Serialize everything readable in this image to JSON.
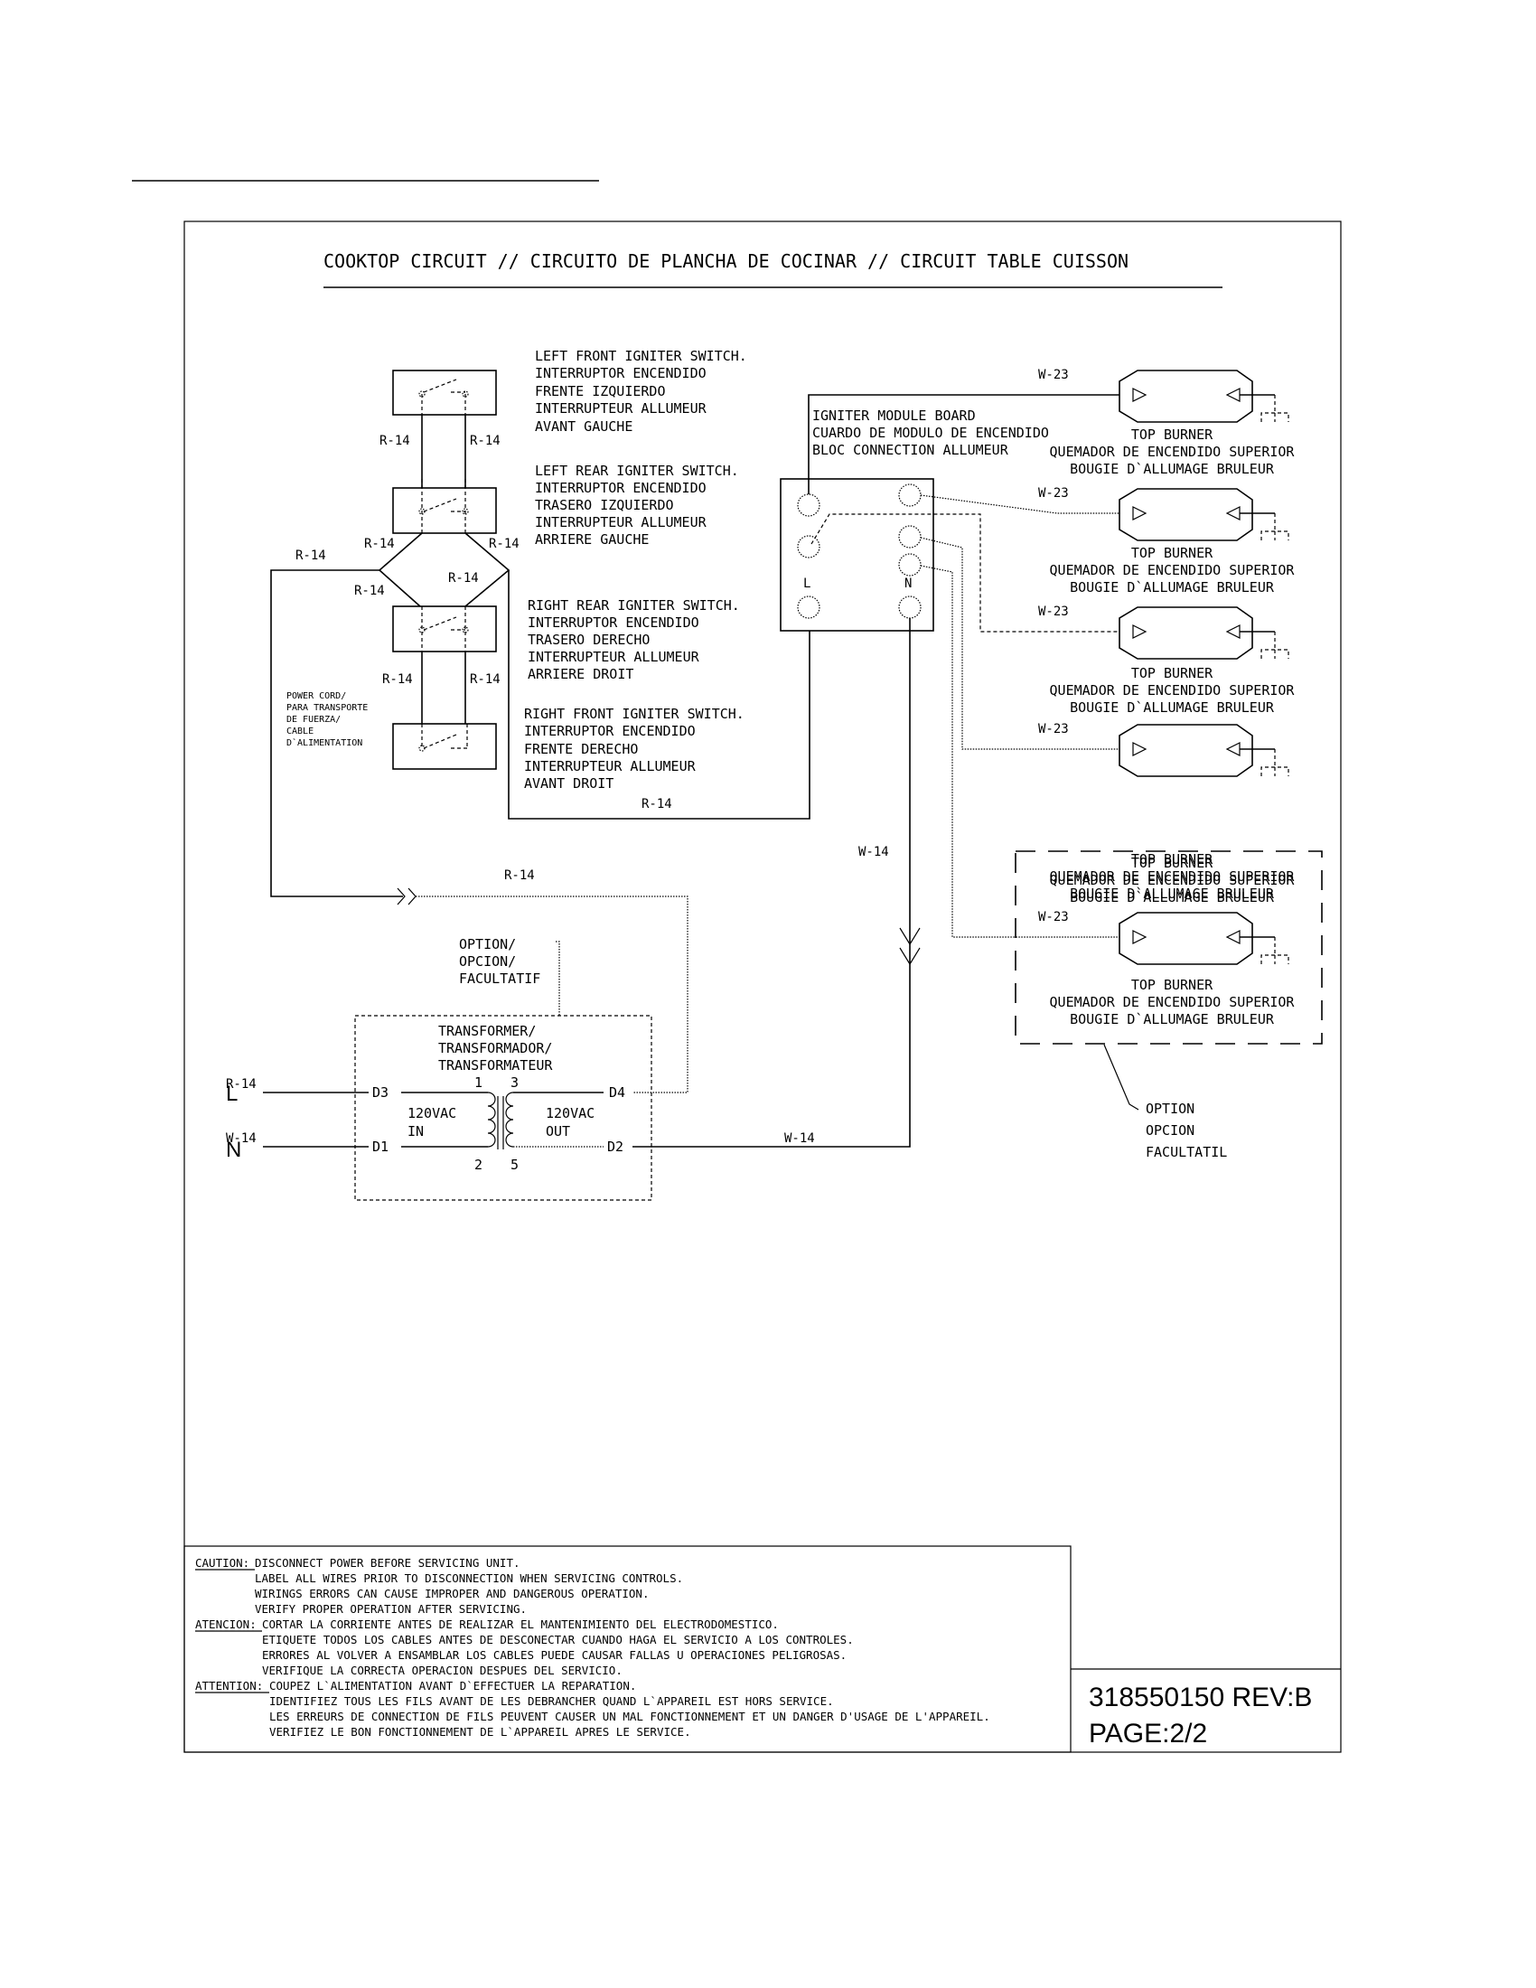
{
  "title": "COOKTOP CIRCUIT // CIRCUITO DE PLANCHA DE COCINAR // CIRCUIT TABLE CUISSON",
  "switches": [
    {
      "name": "left-front",
      "lines": [
        "LEFT FRONT IGNITER SWITCH.",
        "INTERRUPTOR  ENCENDIDO",
        "FRENTE IZQUIERDO",
        "INTERRUPTEUR ALLUMEUR",
        "AVANT GAUCHE"
      ]
    },
    {
      "name": "left-rear",
      "lines": [
        "LEFT REAR IGNITER SWITCH.",
        "INTERRUPTOR ENCENDIDO",
        "TRASERO IZQUIERDO",
        "INTERRUPTEUR ALLUMEUR",
        "ARRIERE GAUCHE"
      ]
    },
    {
      "name": "right-rear",
      "lines": [
        "RIGHT REAR IGNITER SWITCH.",
        "INTERRUPTOR ENCENDIDO",
        "TRASERO DERECHO",
        "INTERRUPTEUR ALLUMEUR",
        "ARRIERE DROIT"
      ]
    },
    {
      "name": "right-front",
      "lines": [
        "RIGHT FRONT IGNITER SWITCH.",
        "INTERRUPTOR  ENCENDIDO",
        "FRENTE DERECHO",
        "INTERRUPTEUR ALLUMEUR",
        "AVANT DROIT"
      ]
    }
  ],
  "wire_labels": {
    "r14": "R-14",
    "w14": "W-14",
    "w23": "W-23"
  },
  "power_cord": [
    "POWER CORD/",
    "PARA TRANSPORTE",
    "DE FUERZA/",
    "CABLE",
    "D`ALIMENTATION"
  ],
  "module": {
    "lines": [
      "IGNITER MODULE BOARD",
      "CUARDO DE MODULO DE ENCENDIDO",
      "BLOC CONNECTION ALLUMEUR"
    ],
    "terminal_l": "L",
    "terminal_n": "N"
  },
  "burner_label": [
    "TOP BURNER",
    "QUEMADOR DE ENCENDIDO SUPERIOR",
    "BOUGIE D`ALLUMAGE BRULEUR"
  ],
  "option_transformer": [
    "OPTION/",
    "OPCION/",
    "FACULTATIF"
  ],
  "transformer": {
    "title": [
      "TRANSFORMER/",
      "TRANSFORMADOR/",
      "TRANSFORMATEUR"
    ],
    "terminals": {
      "d1": "D1",
      "d2": "D2",
      "d3": "D3",
      "d4": "D4"
    },
    "pins": {
      "p1": "1",
      "p2": "2",
      "p3": "3",
      "p5": "5"
    },
    "input": [
      "120VAC",
      "IN"
    ],
    "output": [
      "120VAC",
      "OUT"
    ]
  },
  "line_labels": {
    "line": "L",
    "neutral": "N"
  },
  "option_burner": [
    "OPTION",
    "OPCION",
    "FACULTATIL"
  ],
  "caution": {
    "en_head": "CAUTION:",
    "en": [
      "DISCONNECT POWER BEFORE SERVICING UNIT.",
      "LABEL ALL WIRES PRIOR TO DISCONNECTION WHEN SERVICING CONTROLS.",
      "WIRINGS ERRORS CAN CAUSE IMPROPER AND DANGEROUS OPERATION.",
      "VERIFY PROPER OPERATION AFTER SERVICING."
    ],
    "es_head": "ATENCION:",
    "es": [
      "CORTAR LA CORRIENTE ANTES DE REALIZAR EL MANTENIMIENTO DEL ELECTRODOMESTICO.",
      "ETIQUETE TODOS LOS CABLES ANTES DE DESCONECTAR CUANDO HAGA EL SERVICIO A LOS CONTROLES.",
      "ERRORES AL VOLVER A ENSAMBLAR LOS CABLES PUEDE CAUSAR FALLAS U OPERACIONES PELIGROSAS.",
      "VERIFIQUE LA CORRECTA OPERACION DESPUES DEL SERVICIO."
    ],
    "fr_head": "ATTENTION:",
    "fr": [
      "COUPEZ L`ALIMENTATION AVANT D`EFFECTUER LA REPARATION.",
      "IDENTIFIEZ TOUS LES FILS AVANT DE LES DEBRANCHER QUAND L`APPAREIL EST HORS SERVICE.",
      "LES ERREURS DE CONNECTION DE FILS PEUVENT CAUSER UN MAL FONCTIONNEMENT ET UN DANGER D'USAGE DE L'APPAREIL.",
      "VERIFIEZ LE BON FONCTIONNEMENT DE L`APPAREIL APRES LE SERVICE."
    ]
  },
  "doc_number": "318550150 REV:B",
  "page": "PAGE:2/2"
}
